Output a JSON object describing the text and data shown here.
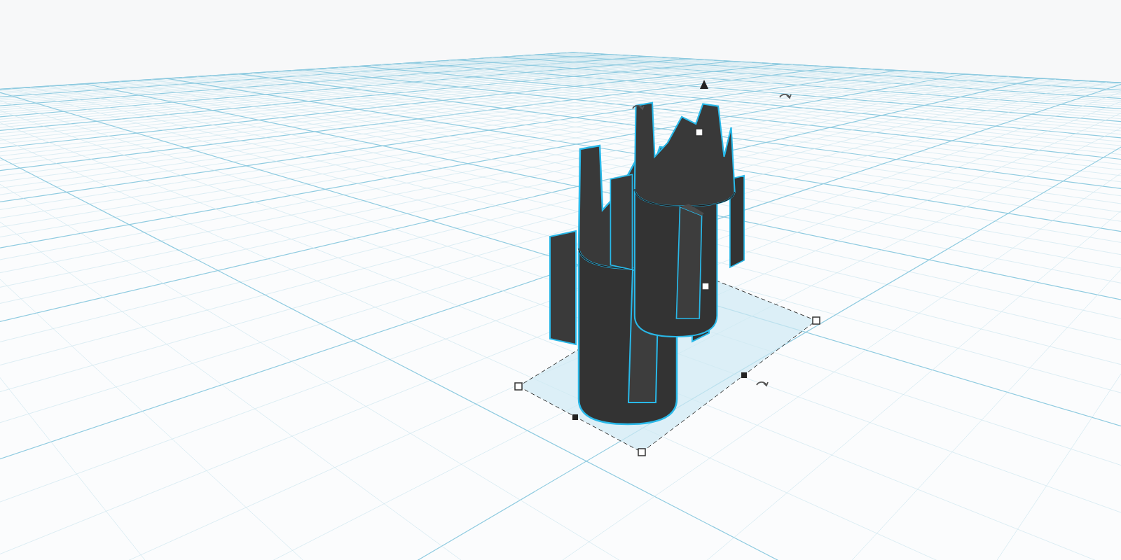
{
  "shapes": [
    {
      "kind": "crown",
      "selected": true
    },
    {
      "kind": "crown",
      "selected": true
    }
  ]
}
